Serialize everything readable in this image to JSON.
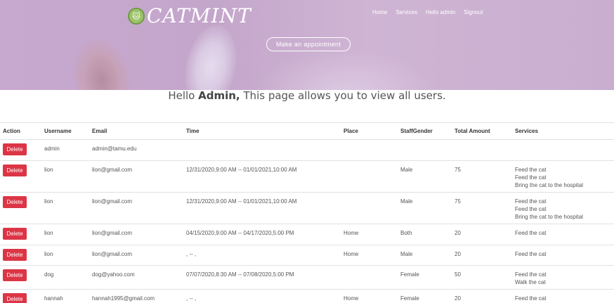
{
  "brand": {
    "name": "CATMINT",
    "badge": "🐱"
  },
  "nav": {
    "items": [
      "Home",
      "Services",
      "Hello admin",
      "Signout"
    ]
  },
  "hero": {
    "cta": "Make an appointment"
  },
  "heading": {
    "prefix": "Hello ",
    "name": "Admin,",
    "suffix": " This page allows you to view all users."
  },
  "table": {
    "headers": [
      "Action",
      "Username",
      "Email",
      "Time",
      "Place",
      "StaffGender",
      "Total Amount",
      "Services"
    ],
    "rows": [
      {
        "action": "Delete",
        "username": "admin",
        "email": "admin@tamu.edu",
        "time": "",
        "place": "",
        "gender": "",
        "amount": "",
        "services": []
      },
      {
        "action": "Delete",
        "username": "lion",
        "email": "lion@gmail.com",
        "time": "12/31/2020,9:00 AM -- 01/01/2021,10:00 AM",
        "place": "",
        "gender": "Male",
        "amount": "75",
        "services": [
          "Feed the cat",
          "Feed the cat",
          "Bring the cat to the hospital"
        ]
      },
      {
        "action": "Delete",
        "username": "lion",
        "email": "lion@gmail.com",
        "time": "12/31/2020,9:00 AM -- 01/01/2021,10:00 AM",
        "place": "",
        "gender": "Male",
        "amount": "75",
        "services": [
          "Feed the cat",
          "Feed the cat",
          "Bring the cat to the hospital"
        ]
      },
      {
        "action": "Delete",
        "username": "lion",
        "email": "lion@gmail.com",
        "time": "04/15/2020,9:00 AM -- 04/17/2020,5:00 PM",
        "place": "Home",
        "gender": "Both",
        "amount": "20",
        "services": [
          "Feed the cat"
        ]
      },
      {
        "action": "Delete",
        "username": "lion",
        "email": "lion@gmail.com",
        "time": ", -- ,",
        "place": "Home",
        "gender": "Male",
        "amount": "20",
        "services": [
          "Feed the cat"
        ]
      },
      {
        "action": "Delete",
        "username": "dog",
        "email": "dog@yahoo.com",
        "time": "07/07/2020,8:30 AM -- 07/08/2020,5:00 PM",
        "place": "",
        "gender": "Female",
        "amount": "50",
        "services": [
          "Feed the cat",
          "Walk the cat"
        ]
      },
      {
        "action": "Delete",
        "username": "hannah",
        "email": "hannah1995@gmail.com",
        "time": ", -- ,",
        "place": "Home",
        "gender": "Female",
        "amount": "20",
        "services": [
          "Feed the cat"
        ]
      }
    ]
  },
  "colors": {
    "hero": "#c7a8cf",
    "delete": "#dc3545",
    "border": "#dee2e6"
  }
}
